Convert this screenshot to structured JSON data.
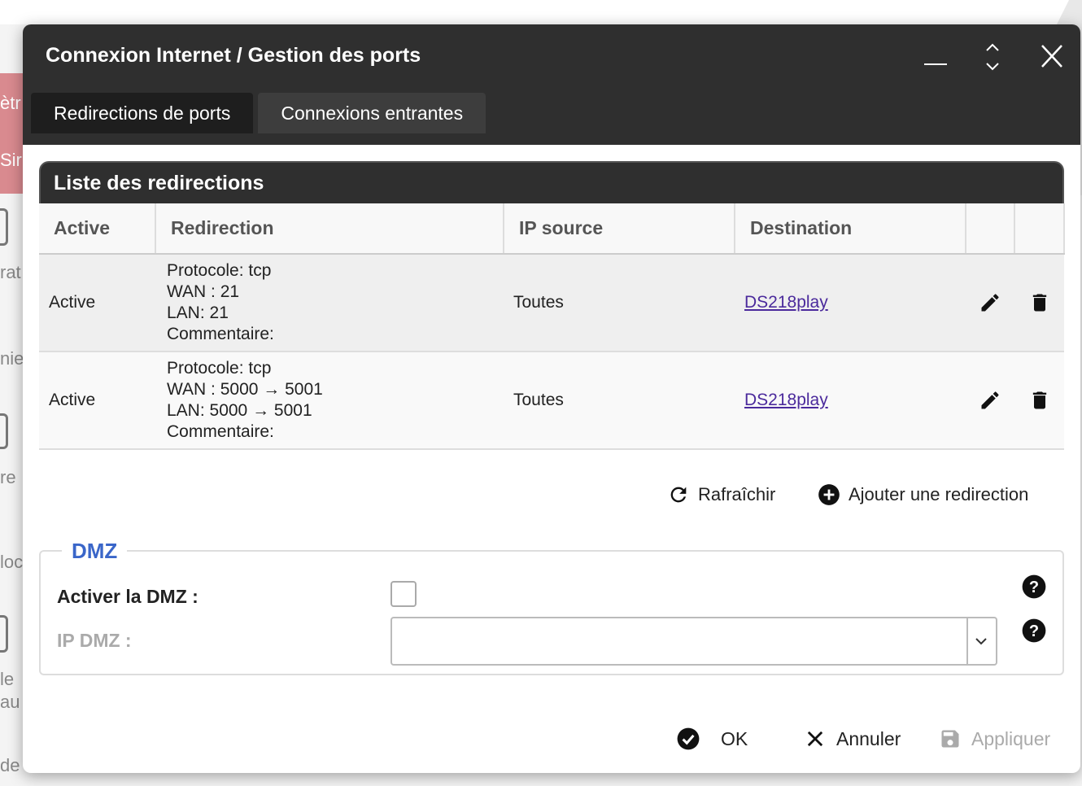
{
  "background": {
    "fragments": [
      "ètr",
      "Sir",
      "rat",
      "nie",
      "re",
      "loc",
      "le",
      "au",
      "de"
    ]
  },
  "dialog": {
    "title": "Connexion Internet / Gestion des ports",
    "window_icons": [
      "minimize-icon",
      "maximize-icon",
      "close-icon"
    ]
  },
  "tabs": [
    {
      "label": "Redirections de ports",
      "active": true
    },
    {
      "label": "Connexions entrantes",
      "active": false
    }
  ],
  "redirections": {
    "title": "Liste des redirections",
    "columns": [
      "Active",
      "Redirection",
      "IP source",
      "Destination",
      "",
      ""
    ],
    "rows": [
      {
        "active": "Active",
        "protocol": "Protocole: tcp",
        "wan": "WAN : 21",
        "lan": "LAN: 21",
        "comment": "Commentaire:",
        "ip_source": "Toutes",
        "destination": "DS218play"
      },
      {
        "active": "Active",
        "protocol": "Protocole: tcp",
        "wan": "WAN : 5000 → 5001",
        "lan": "LAN: 5000 → 5001",
        "comment": "Commentaire:",
        "ip_source": "Toutes",
        "destination": "DS218play"
      }
    ],
    "refresh_label": "Rafraîchir",
    "add_label": "Ajouter une redirection"
  },
  "dmz": {
    "legend": "DMZ",
    "enable_label": "Activer la DMZ :",
    "enabled": false,
    "ip_label": "IP DMZ :",
    "ip_value": ""
  },
  "footer": {
    "ok_label": "OK",
    "cancel_label": "Annuler",
    "apply_label": "Appliquer"
  },
  "colors": {
    "header_bg": "#2f2f2f",
    "accent_blue": "#3a66c9",
    "link": "#4b2a9c",
    "background_red": "#d98a8f"
  }
}
